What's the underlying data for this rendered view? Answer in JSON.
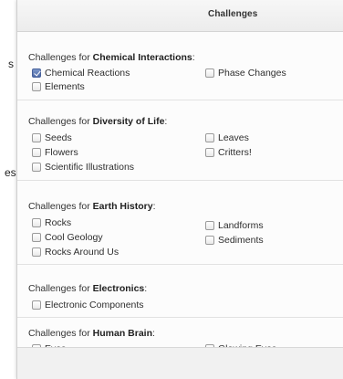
{
  "background": {
    "fragment_1": "s",
    "fragment_2": "es"
  },
  "dialog": {
    "title": "Challenges",
    "heading_prefix": "Challenges for",
    "sections": [
      {
        "topic": "Chemical Interactions",
        "items": [
          {
            "label": "Chemical Reactions",
            "checked": true
          },
          {
            "label": "Phase Changes",
            "checked": false
          },
          {
            "label": "Elements",
            "checked": false
          }
        ]
      },
      {
        "topic": "Diversity of Life",
        "items": [
          {
            "label": "Seeds",
            "checked": false
          },
          {
            "label": "Leaves",
            "checked": false
          },
          {
            "label": "Flowers",
            "checked": false
          },
          {
            "label": "Critters!",
            "checked": false
          },
          {
            "label": "Scientific Illustrations",
            "checked": false
          }
        ]
      },
      {
        "topic": "Earth History",
        "items": [
          {
            "label": "Rocks",
            "checked": false
          },
          {
            "label": "Landforms",
            "checked": false
          },
          {
            "label": "Cool Geology",
            "checked": false
          },
          {
            "label": "Sediments",
            "checked": false
          },
          {
            "label": "Rocks Around Us",
            "checked": false
          }
        ]
      },
      {
        "topic": "Electronics",
        "items": [
          {
            "label": "Electronic Components",
            "checked": false
          }
        ]
      },
      {
        "topic": "Human Brain",
        "items": [
          {
            "label": "Eyes",
            "checked": false
          },
          {
            "label": "Glowing Eyes",
            "checked": false
          }
        ]
      }
    ]
  }
}
